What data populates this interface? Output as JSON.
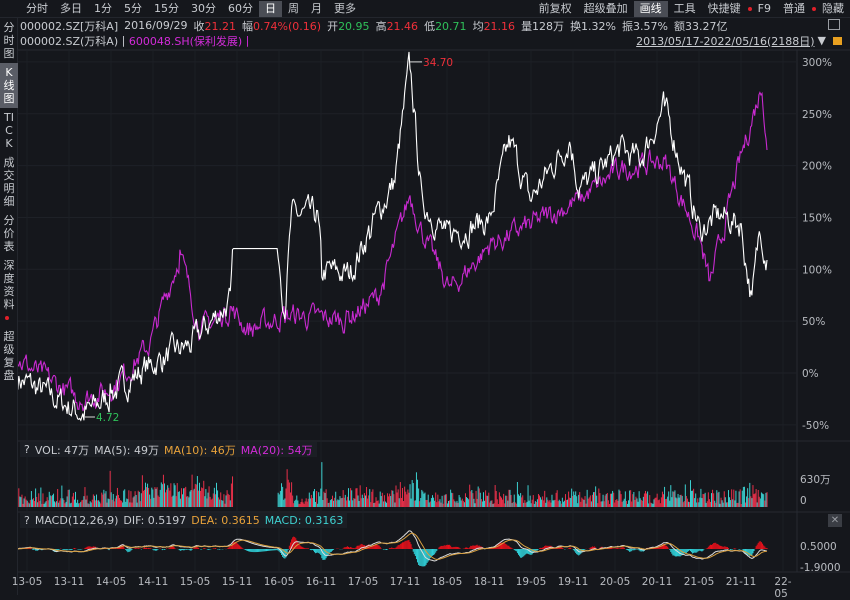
{
  "toolbar": {
    "periods": [
      "分时",
      "多日",
      "1分",
      "5分",
      "15分",
      "30分",
      "60分",
      "日",
      "周",
      "月",
      "更多"
    ],
    "active": "日",
    "right": [
      "前复权",
      "超级叠加",
      "画线",
      "工具",
      "快捷键",
      "F9",
      "普通",
      "隐藏"
    ]
  },
  "info": {
    "code": "000002.SZ[万科A]",
    "date": "2016/09/29",
    "close_label": "收",
    "close": "21.21",
    "chg_label": "幅",
    "chg": "0.74%(0.16)",
    "open_label": "开",
    "open": "20.95",
    "high_label": "高",
    "high": "21.46",
    "low_label": "低",
    "low": "20.71",
    "avg_label": "均",
    "avg": "21.16",
    "vol": "量128万",
    "turnover": "换1.32%",
    "amplitude": "振3.57%",
    "amount": "额33.27亿"
  },
  "legend": {
    "main": "000002.SZ(万科A)",
    "sep": "|",
    "overlay": "600048.SH(保利发展)",
    "sep2": "|"
  },
  "range": {
    "text": "2013/05/17-2022/05/16(2188日)",
    "arrow": "▼",
    "lock": "lock-icon"
  },
  "sidebar": [
    "分时图",
    "K线图",
    "TICK",
    "成交明细",
    "分价表",
    "深度资料",
    "超级复盘"
  ],
  "vol_header": {
    "q": "?",
    "vol": "VOL: 47万",
    "ma5": "MA(5): 49万",
    "ma10": "MA(10): 46万",
    "ma20": "MA(20): 54万"
  },
  "macd_header": {
    "q": "?",
    "name": "MACD(12,26,9)",
    "dif": "DIF: 0.5197",
    "dea": "DEA: 0.3615",
    "macd": "MACD: 0.3163"
  },
  "vol_axis": [
    "630万",
    "0"
  ],
  "macd_axis": [
    "0.5000",
    "-1.9000"
  ],
  "close_label": "✕",
  "chart_data": {
    "type": "line",
    "title": "000002.SZ vs 600048.SH cumulative % change",
    "ylabel": "%",
    "ylim": [
      -55,
      310
    ],
    "yticks": [
      "300%",
      "250%",
      "200%",
      "150%",
      "100%",
      "50%",
      "0%",
      "-50%"
    ],
    "ytick_values": [
      300,
      250,
      200,
      150,
      100,
      50,
      0,
      -50
    ],
    "xticks": [
      "13-05",
      "13-11",
      "14-05",
      "14-11",
      "15-05",
      "15-11",
      "16-05",
      "16-11",
      "17-05",
      "17-11",
      "18-05",
      "18-11",
      "19-05",
      "19-11",
      "20-05",
      "20-11",
      "21-05",
      "21-11",
      "22-05"
    ],
    "max_label": "34.70",
    "min_label": "4.72",
    "series": [
      {
        "name": "000002.SZ(万科A)",
        "color": "#ffffff",
        "points": [
          [
            2013.22,
            -5
          ],
          [
            2014.02,
            -40.5
          ],
          [
            2014.32,
            -21
          ],
          [
            2014.79,
            8
          ],
          [
            2015.27,
            27
          ],
          [
            2015.75,
            70
          ],
          [
            2015.79,
            120
          ],
          [
            2016.32,
            120
          ],
          [
            2016.4,
            61
          ],
          [
            2016.48,
            152
          ],
          [
            2016.79,
            152
          ],
          [
            2016.84,
            99
          ],
          [
            2017.17,
            95
          ],
          [
            2017.41,
            138
          ],
          [
            2017.71,
            186
          ],
          [
            2017.89,
            300
          ],
          [
            2018.03,
            167
          ],
          [
            2018.31,
            133
          ],
          [
            2018.84,
            148
          ],
          [
            2019.08,
            225
          ],
          [
            2019.32,
            167
          ],
          [
            2019.79,
            225
          ],
          [
            2019.91,
            176
          ],
          [
            2020.39,
            215
          ],
          [
            2020.63,
            205
          ],
          [
            2020.92,
            258
          ],
          [
            2021.34,
            138
          ],
          [
            2021.58,
            152
          ],
          [
            2021.82,
            143
          ],
          [
            2021.96,
            70
          ],
          [
            2022.06,
            143
          ],
          [
            2022.14,
            109
          ]
        ]
      },
      {
        "name": "600048.SH(保利发展)",
        "color": "#c82ad0",
        "points": [
          [
            2013.22,
            13
          ],
          [
            2013.96,
            -26
          ],
          [
            2014.32,
            -16
          ],
          [
            2014.79,
            27
          ],
          [
            2015.15,
            114
          ],
          [
            2015.39,
            41
          ],
          [
            2015.75,
            61
          ],
          [
            2015.98,
            41
          ],
          [
            2016.4,
            56
          ],
          [
            2017.12,
            51
          ],
          [
            2017.53,
            75
          ],
          [
            2017.89,
            172
          ],
          [
            2018.07,
            128
          ],
          [
            2018.37,
            80
          ],
          [
            2018.84,
            123
          ],
          [
            2019.32,
            143
          ],
          [
            2019.91,
            167
          ],
          [
            2020.39,
            196
          ],
          [
            2020.92,
            205
          ],
          [
            2021.34,
            128
          ],
          [
            2021.46,
            85
          ],
          [
            2021.82,
            205
          ],
          [
            2022.08,
            278
          ],
          [
            2022.14,
            215
          ]
        ]
      }
    ]
  }
}
